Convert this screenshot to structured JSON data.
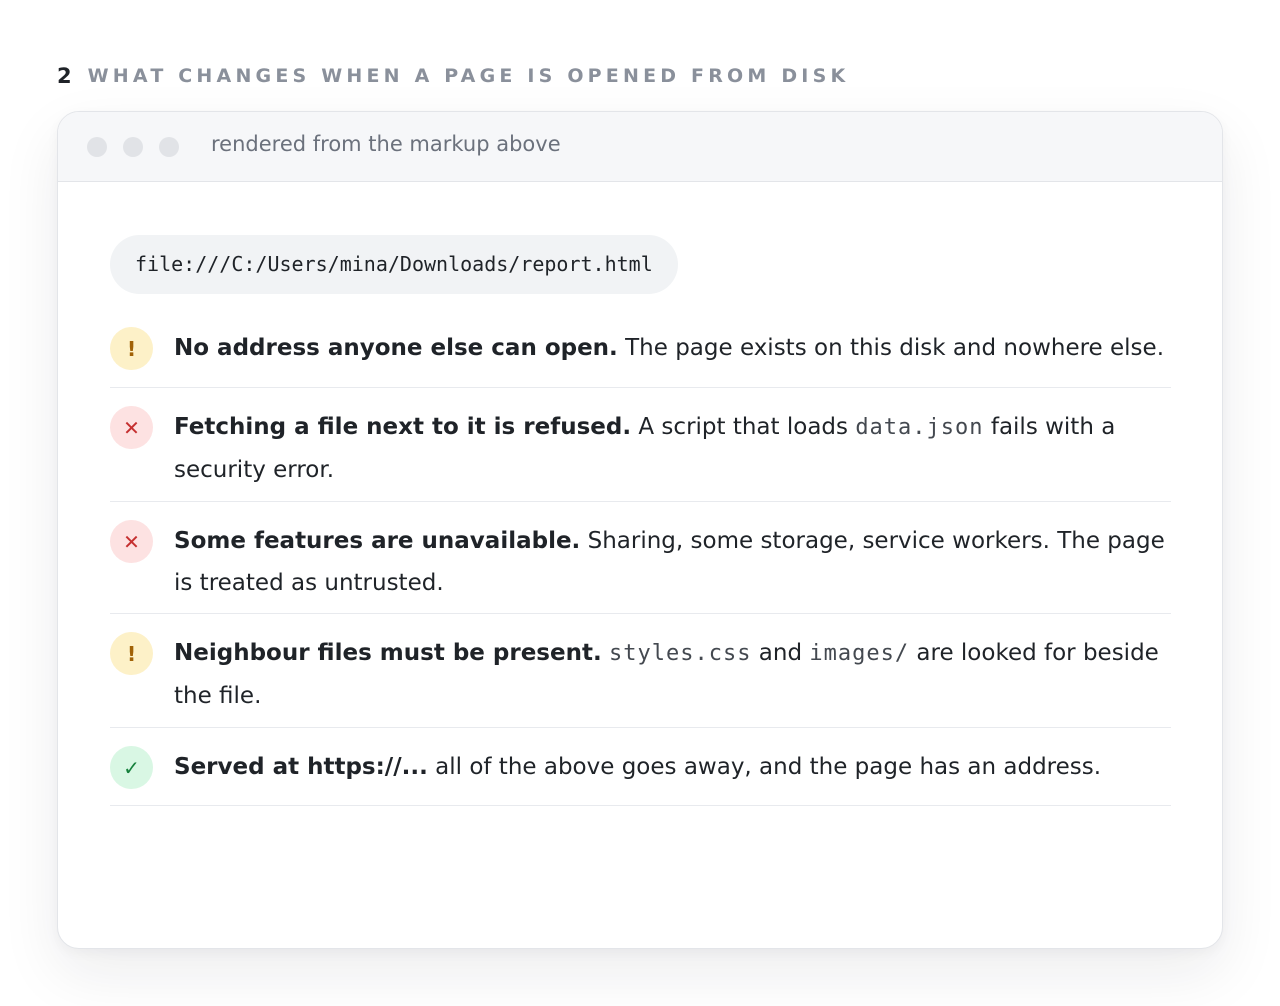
{
  "section": {
    "number": "2",
    "title": "WHAT CHANGES WHEN A PAGE IS OPENED FROM DISK"
  },
  "window": {
    "titlebar_text": "rendered from the markup above",
    "url": "file:///C:/Users/mina/Downloads/report.html"
  },
  "icons": {
    "warning": "!",
    "error": "✕",
    "ok": "✓"
  },
  "colors": {
    "warning_bg": "#fdf1c8",
    "warning_fg": "#a16207",
    "error_bg": "#fde2e2",
    "error_fg": "#c53030",
    "ok_bg": "#d9f7e4",
    "ok_fg": "#16803c"
  },
  "items": [
    {
      "status": "warning",
      "bold": "No address anyone else can open.",
      "text": " The page exists on this disk and nowhere else."
    },
    {
      "status": "error",
      "bold": "Fetching a file next to it is refused.",
      "text_before": " A script that loads ",
      "code": "data.json",
      "text_after": " fails with a security error."
    },
    {
      "status": "error",
      "bold": "Some features are unavailable.",
      "text": " Sharing, some storage, service workers. The page is treated as untrusted."
    },
    {
      "status": "warning",
      "bold": "Neighbour files must be present.",
      "code1": "styles.css",
      "middle": " and ",
      "code2": "images/",
      "text_after": " are looked for beside the file."
    },
    {
      "status": "ok",
      "bold": "Served at https://...",
      "text": " all of the above goes away, and the page has an address."
    }
  ]
}
